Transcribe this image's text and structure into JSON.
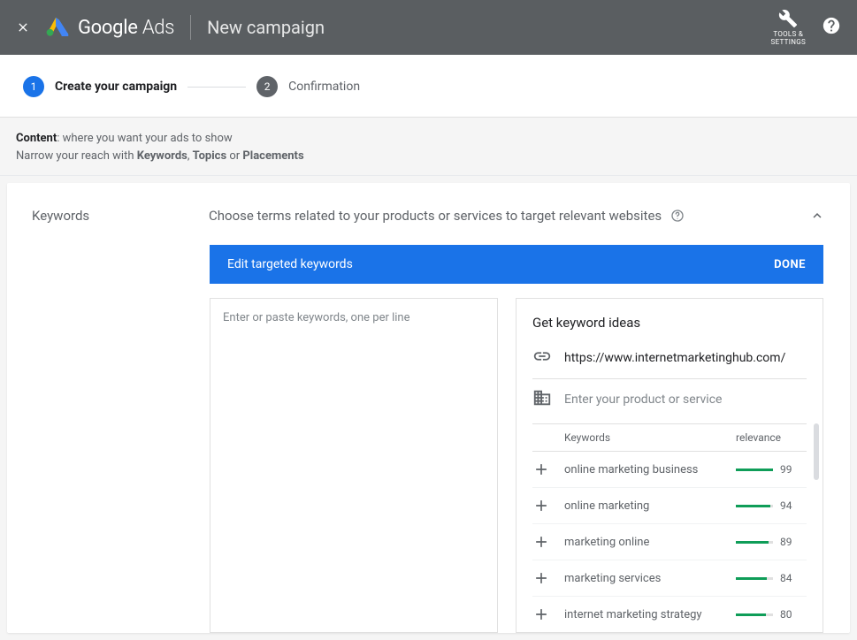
{
  "header": {
    "brand_a": "Google",
    "brand_b": "Ads",
    "page_title": "New campaign",
    "tools_label": "TOOLS &\nSETTINGS"
  },
  "steps": [
    {
      "num": "1",
      "label": "Create your campaign"
    },
    {
      "num": "2",
      "label": "Confirmation"
    }
  ],
  "content_strip": {
    "bold_title": "Content",
    "title_rest": ": where you want your ads to show",
    "sub_prefix": "Narrow your reach with ",
    "kw": "Keywords",
    "sep1": ", ",
    "topics": "Topics",
    "sep2": " or ",
    "placements": "Placements"
  },
  "card": {
    "side_title": "Keywords",
    "description": "Choose terms related to your products or services to target relevant websites"
  },
  "blue_bar": {
    "title": "Edit targeted keywords",
    "done": "DONE"
  },
  "textarea": {
    "placeholder": "Enter or paste keywords, one per line",
    "value": ""
  },
  "ideas": {
    "title": "Get keyword ideas",
    "url_value": "https://www.internetmarketinghub.com/",
    "product_placeholder": "Enter your product or service",
    "th_kw": "Keywords",
    "th_rel": "relevance",
    "rows": [
      {
        "name": "online marketing business",
        "rel": "99"
      },
      {
        "name": "online marketing",
        "rel": "94"
      },
      {
        "name": "marketing online",
        "rel": "89"
      },
      {
        "name": "marketing services",
        "rel": "84"
      },
      {
        "name": "internet marketing strategy",
        "rel": "80"
      }
    ]
  }
}
